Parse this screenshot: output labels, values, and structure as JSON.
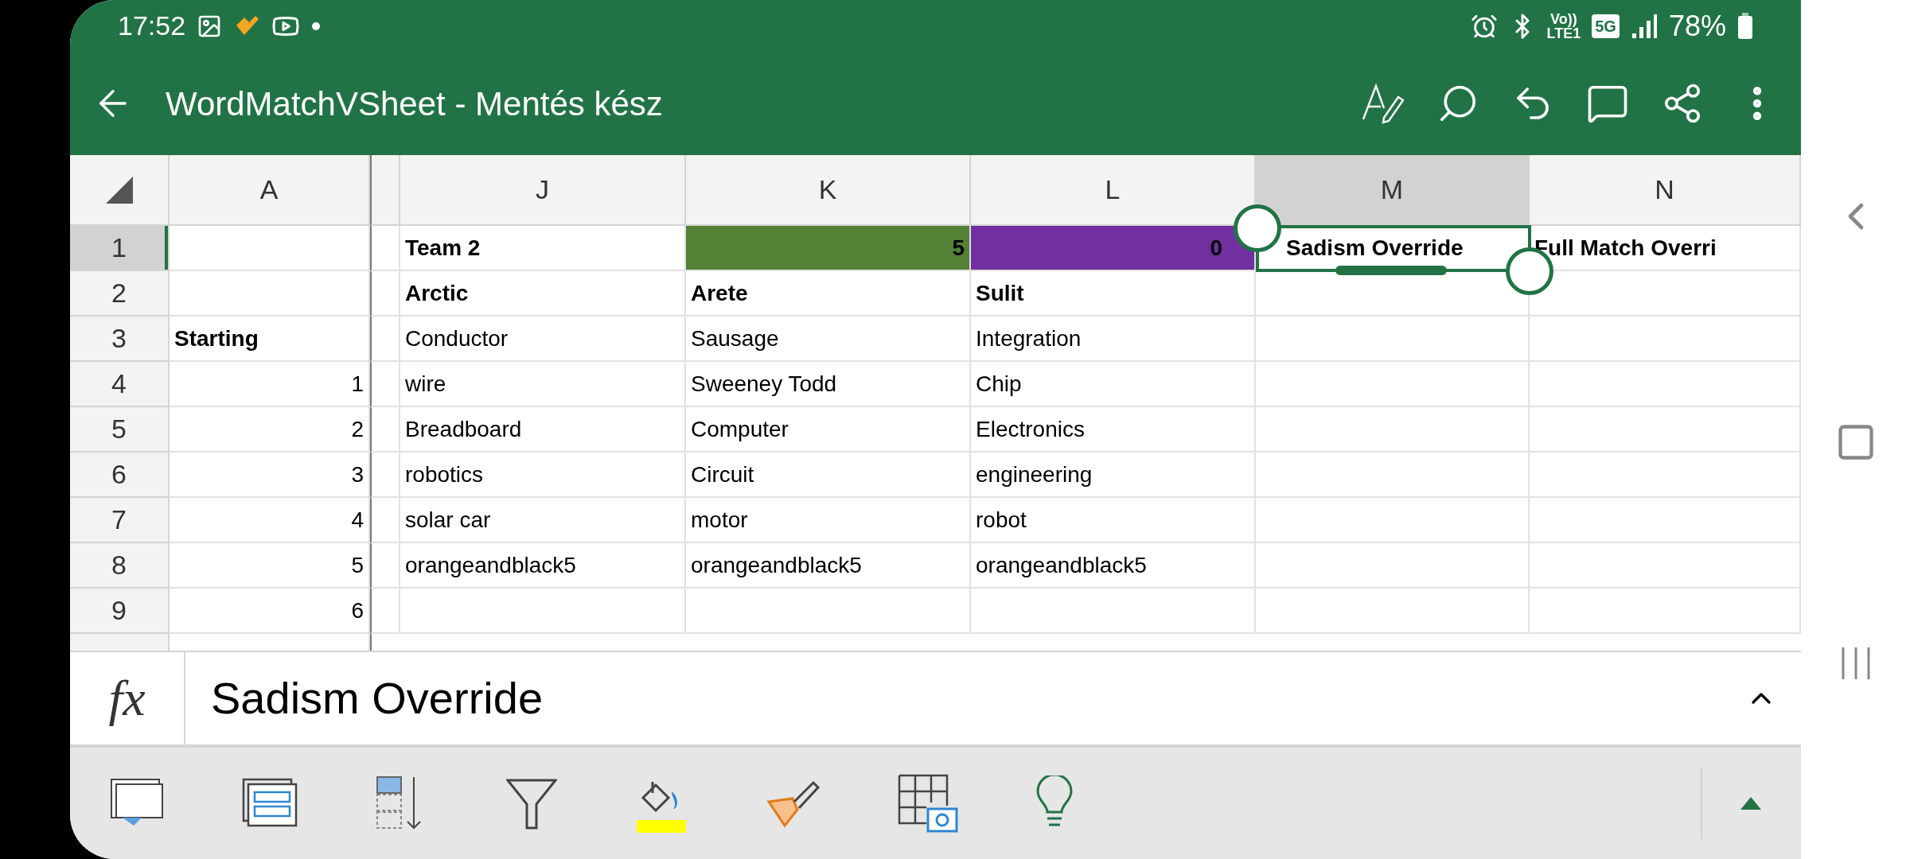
{
  "status_bar": {
    "time": "17:52",
    "volte": "Vo))",
    "lte": "LTE1",
    "network": "5G",
    "battery": "78%"
  },
  "title_bar": {
    "title": "WordMatchVSheet - Mentés kész"
  },
  "columns": [
    {
      "label": "A",
      "selected": false
    },
    {
      "label": "J",
      "selected": false
    },
    {
      "label": "K",
      "selected": false
    },
    {
      "label": "L",
      "selected": false
    },
    {
      "label": "M",
      "selected": true
    },
    {
      "label": "N",
      "selected": false
    }
  ],
  "rows": [
    {
      "label": "1",
      "selected": true,
      "cells": [
        {
          "text": ""
        },
        {
          "text": "Team 2",
          "bold": true
        },
        {
          "text": "5",
          "bold": true,
          "kind": "number",
          "color": "#538135"
        },
        {
          "text": "0",
          "bold": true,
          "kind": "number",
          "color": "#7030a0"
        },
        {
          "text": "Sadism Override",
          "bold": true
        },
        {
          "text": "Full Match Overri",
          "bold": true
        }
      ]
    },
    {
      "label": "2",
      "selected": false,
      "cells": [
        {
          "text": ""
        },
        {
          "text": "Arctic",
          "bold": true
        },
        {
          "text": "Arete",
          "bold": true
        },
        {
          "text": "Sulit",
          "bold": true
        },
        {
          "text": ""
        },
        {
          "text": ""
        }
      ]
    },
    {
      "label": "3",
      "selected": false,
      "cells": [
        {
          "text": "Starting",
          "bold": true
        },
        {
          "text": "Conductor"
        },
        {
          "text": "Sausage"
        },
        {
          "text": "Integration"
        },
        {
          "text": ""
        },
        {
          "text": ""
        }
      ]
    },
    {
      "label": "4",
      "selected": false,
      "cells": [
        {
          "text": "1",
          "kind": "number"
        },
        {
          "text": "wire"
        },
        {
          "text": "Sweeney Todd"
        },
        {
          "text": "Chip"
        },
        {
          "text": ""
        },
        {
          "text": ""
        }
      ]
    },
    {
      "label": "5",
      "selected": false,
      "cells": [
        {
          "text": "2",
          "kind": "number"
        },
        {
          "text": "Breadboard"
        },
        {
          "text": "Computer"
        },
        {
          "text": "Electronics"
        },
        {
          "text": ""
        },
        {
          "text": ""
        }
      ]
    },
    {
      "label": "6",
      "selected": false,
      "cells": [
        {
          "text": "3",
          "kind": "number"
        },
        {
          "text": "robotics"
        },
        {
          "text": "Circuit"
        },
        {
          "text": "engineering"
        },
        {
          "text": ""
        },
        {
          "text": ""
        }
      ]
    },
    {
      "label": "7",
      "selected": false,
      "cells": [
        {
          "text": "4",
          "kind": "number"
        },
        {
          "text": "solar car"
        },
        {
          "text": "motor"
        },
        {
          "text": "robot"
        },
        {
          "text": ""
        },
        {
          "text": ""
        }
      ]
    },
    {
      "label": "8",
      "selected": false,
      "cells": [
        {
          "text": "5",
          "kind": "number"
        },
        {
          "text": "orangeandblack5"
        },
        {
          "text": "orangeandblack5"
        },
        {
          "text": "orangeandblack5"
        },
        {
          "text": ""
        },
        {
          "text": ""
        }
      ]
    },
    {
      "label": "9",
      "selected": false,
      "cells": [
        {
          "text": "6",
          "kind": "number"
        },
        {
          "text": ""
        },
        {
          "text": ""
        },
        {
          "text": ""
        },
        {
          "text": ""
        },
        {
          "text": ""
        }
      ]
    }
  ],
  "formula_bar": {
    "fx": "fx",
    "value": "Sadism Override"
  }
}
